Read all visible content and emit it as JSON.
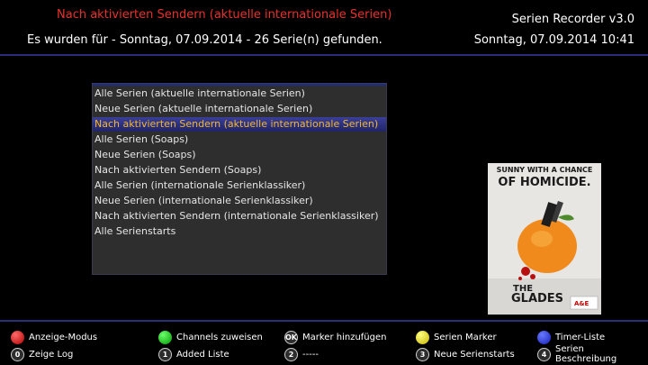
{
  "header": {
    "title": "Nach aktivierten Sendern (aktuelle internationale Serien)",
    "status": "Es wurden für - Sonntag, 07.09.2014 - 26 Serie(n) gefunden.",
    "app_title": "Serien Recorder v3.0",
    "datetime": "Sonntag, 07.09.2014  10:41"
  },
  "colors": {
    "title_red": "#e8312c",
    "selected_text": "#f4b828",
    "separator": "#2a2d7a",
    "selection_bg": "#2e3385"
  },
  "menu": {
    "selected_index": 2,
    "items": [
      {
        "label": "Alle Serien (aktuelle internationale Serien)"
      },
      {
        "label": "Neue Serien (aktuelle internationale Serien)"
      },
      {
        "label": "Nach aktivierten Sendern (aktuelle internationale Serien)"
      },
      {
        "label": "Alle Serien (Soaps)"
      },
      {
        "label": "Neue Serien (Soaps)"
      },
      {
        "label": "Nach aktivierten Sendern (Soaps)"
      },
      {
        "label": "Alle Serien (internationale Serienklassiker)"
      },
      {
        "label": "Neue Serien (internationale Serienklassiker)"
      },
      {
        "label": "Nach aktivierten Sendern (internationale Serienklassiker)"
      },
      {
        "label": "Alle Serienstarts"
      }
    ]
  },
  "poster": {
    "tagline_line1": "SUNNY WITH A CHANCE",
    "tagline_line2": "OF HOMICIDE."
  },
  "footer": {
    "row1": [
      {
        "icon": "red-button-icon",
        "label": "Anzeige-Modus"
      },
      {
        "icon": "green-button-icon",
        "label": "Channels zuweisen"
      },
      {
        "icon": "ok-button-icon",
        "key": "OK",
        "label": "Marker hinzufügen"
      },
      {
        "icon": "yellow-button-icon",
        "label": "Serien Marker"
      },
      {
        "icon": "blue-button-icon",
        "label": "Timer-Liste"
      }
    ],
    "row2": [
      {
        "icon": "key-0-icon",
        "key": "0",
        "label": "Zeige Log"
      },
      {
        "icon": "key-1-icon",
        "key": "1",
        "label": "Added Liste"
      },
      {
        "icon": "key-2-icon",
        "key": "2",
        "label": "-----"
      },
      {
        "icon": "key-3-icon",
        "key": "3",
        "label": "Neue Serienstarts"
      },
      {
        "icon": "key-4-icon",
        "key": "4",
        "label": "Serien Beschreibung"
      }
    ]
  }
}
